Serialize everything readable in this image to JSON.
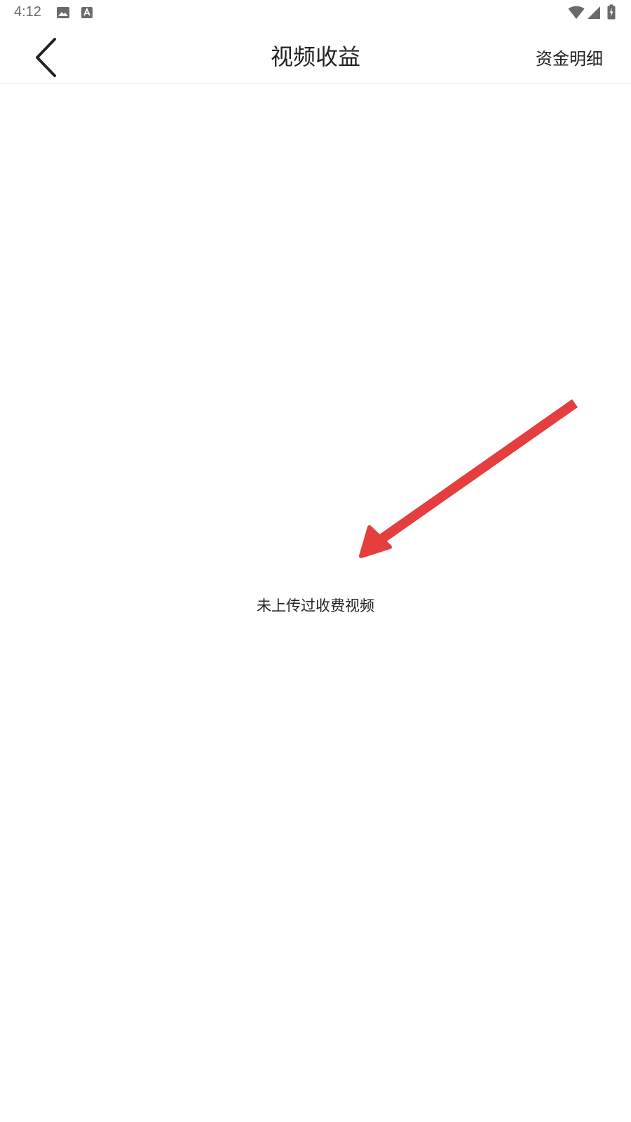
{
  "status_bar": {
    "time": "4:12",
    "icons": {
      "left": [
        "image-notification-icon",
        "font-notification-icon"
      ],
      "right": [
        "wifi-icon",
        "cell-signal-icon",
        "battery-charging-icon"
      ]
    },
    "icon_color": "#6a6a6a"
  },
  "nav": {
    "back_icon": "chevron-left-icon",
    "title": "视频收益",
    "details_label": "资金明细"
  },
  "empty_state": {
    "message": "未上传过收费视频"
  },
  "annotation": {
    "arrow_color": "#e53e3e"
  }
}
